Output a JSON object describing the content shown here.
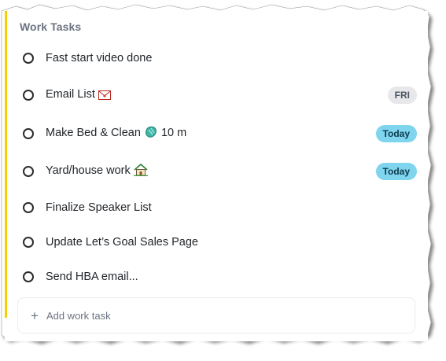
{
  "section": {
    "title": "Work Tasks"
  },
  "tasks": [
    {
      "label": "Fast start video done",
      "badge": null
    },
    {
      "label": "Email List",
      "emoji": "envelope-icon",
      "badge": "FRI",
      "badge_style": "fri"
    },
    {
      "label": "Make Bed & Clean",
      "emoji": "broom-icon",
      "suffix": "10 m",
      "badge": "Today",
      "badge_style": "today"
    },
    {
      "label": "Yard/house work",
      "emoji": "house-icon",
      "badge": "Today",
      "badge_style": "today"
    },
    {
      "label": "Finalize Speaker List",
      "badge": null
    },
    {
      "label": "Update Let’s Goal Sales Page",
      "badge": null
    },
    {
      "label": "Send HBA email...",
      "badge": null
    }
  ],
  "add_task": {
    "plus": "+",
    "label": "Add work task"
  },
  "colors": {
    "accent": "#f4d000",
    "today_badge": "#7fd4ee",
    "fri_badge": "#e8e8ea"
  }
}
